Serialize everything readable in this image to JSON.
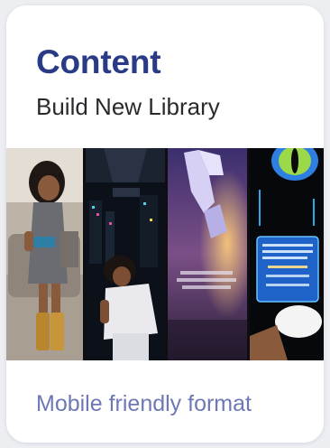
{
  "card": {
    "title": "Content",
    "subtitle": "Build New Library",
    "footer": "Mobile friendly format"
  },
  "comic_strip": {
    "panels": [
      {
        "icon": "reading-girl-illustration"
      },
      {
        "icon": "night-city-girl-illustration"
      },
      {
        "icon": "glowing-hand-illustration"
      },
      {
        "icon": "cat-eye-screen-illustration"
      }
    ]
  },
  "colors": {
    "title": "#2a3b86",
    "subtitle": "#2a2a2e",
    "footer": "#6e78b5",
    "card_background": "#ffffff"
  }
}
